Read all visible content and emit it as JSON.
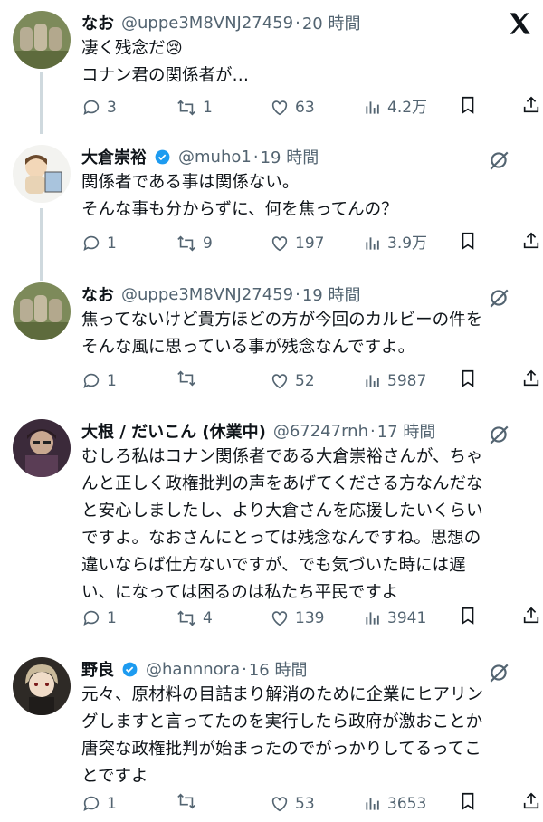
{
  "tweets": [
    {
      "name": "なお",
      "verified": false,
      "handle": "@uppe3M8VNJ27459",
      "time": "20 時間",
      "text": "凄く残念だ😢\nコナン君の関係者が…",
      "replies": "3",
      "retweets": "1",
      "likes": "63",
      "views": "4.2万"
    },
    {
      "name": "大倉崇裕",
      "verified": true,
      "handle": "@muho1",
      "time": "19 時間",
      "text": "関係者である事は関係ない。\nそんな事も分からずに、何を焦ってんの？",
      "replies": "1",
      "retweets": "9",
      "likes": "197",
      "views": "3.9万"
    },
    {
      "name": "なお",
      "verified": false,
      "handle": "@uppe3M8VNJ27459",
      "time": "19 時間",
      "text": "焦ってないけど貴方ほどの方が今回のカルビーの件を\nそんな風に思っている事が残念なんですよ。",
      "replies": "1",
      "retweets": "",
      "likes": "52",
      "views": "5987"
    },
    {
      "name": "大根 / だいこん (休業中)",
      "verified": false,
      "handle": "@67247rnh",
      "time": "17 時間",
      "text": "むしろ私はコナン関係者である大倉崇裕さんが、ちゃ\nんと正しく政権批判の声をあげてくださる方なんだな\nと安心しましたし、より大倉さんを応援したいくらい\nですよ。なおさんにとっては残念なんですね。思想の\n違いならば仕方ないですが、でも気づいた時には遅\nい、になっては困るのは私たち平民ですよ",
      "replies": "1",
      "retweets": "4",
      "likes": "139",
      "views": "3941"
    },
    {
      "name": "野良",
      "verified": true,
      "handle": "@hannnora",
      "time": "16 時間",
      "text": "元々、原材料の目詰まり解消のために企業にヒアリン\nグしますと言ってたのを実行したら政府が激おことか\n唐突な政権批判が始まったのでがっかりしてるってこ\nとですよ",
      "replies": "1",
      "retweets": "",
      "likes": "53",
      "views": "3653"
    }
  ],
  "colors": {
    "text": "#0f1419",
    "secondary": "#536471",
    "verified": "#1d9bf0",
    "thread_line": "#cfd9de"
  },
  "icons": [
    "x-logo-icon",
    "grok-icon",
    "reply-icon",
    "retweet-icon",
    "like-icon",
    "views-icon",
    "bookmark-icon",
    "share-icon",
    "verified-badge-icon"
  ]
}
